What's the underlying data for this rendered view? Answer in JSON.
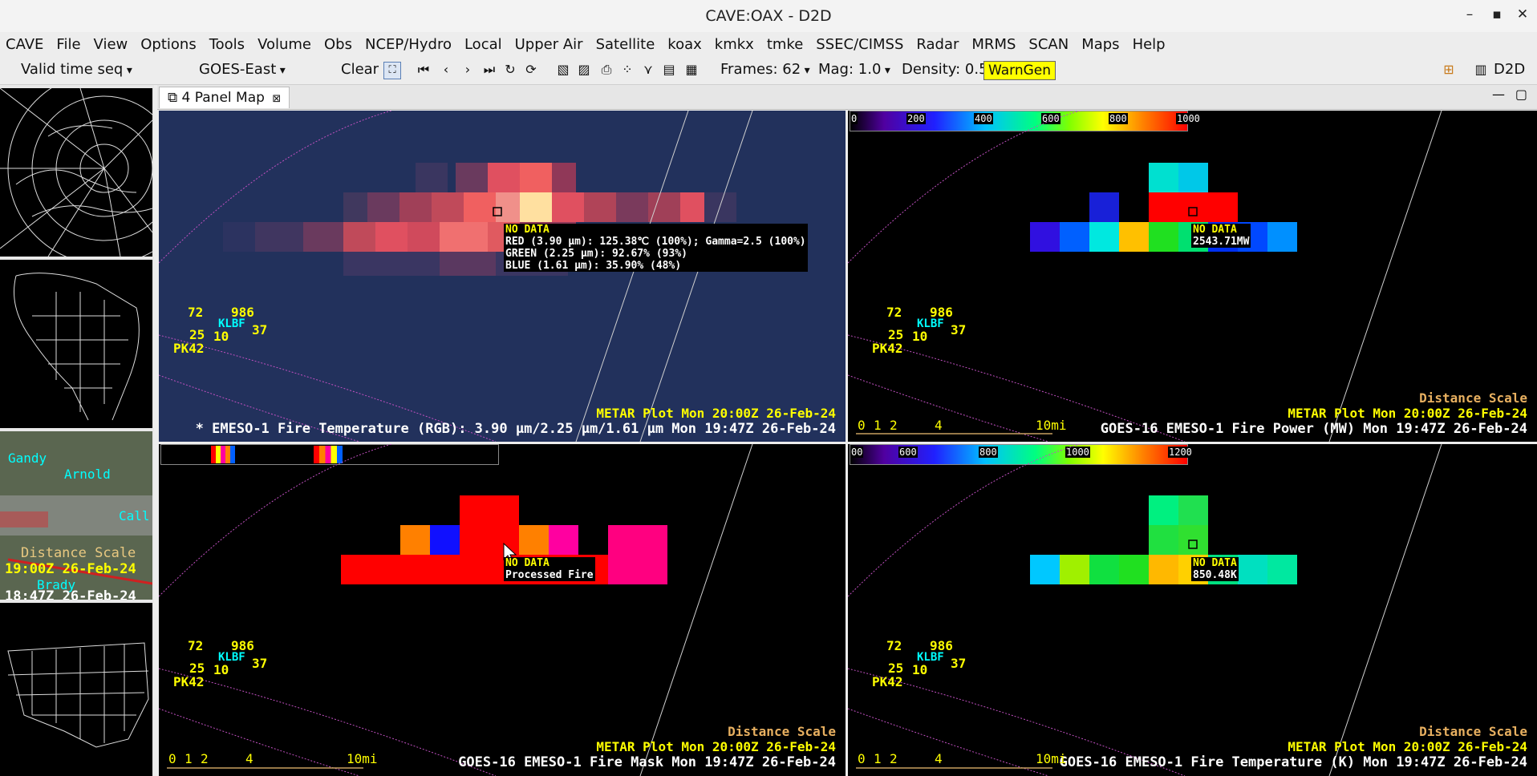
{
  "window": {
    "title": "CAVE:OAX - D2D",
    "minimize": "–",
    "maximize": "▪",
    "close": "✕"
  },
  "menu": [
    "CAVE",
    "File",
    "View",
    "Options",
    "Tools",
    "Volume",
    "Obs",
    "NCEP/Hydro",
    "Local",
    "Upper Air",
    "Satellite",
    "koax",
    "kmkx",
    "tmke",
    "SSEC/CIMSS",
    "Radar",
    "MRMS",
    "SCAN",
    "Maps",
    "Help"
  ],
  "toolbar": {
    "time_mode": "Valid time seq",
    "source": "GOES-East",
    "clear": "Clear",
    "frames": "Frames: 62",
    "mag": "Mag: 1.0",
    "density": "Density: 0.5",
    "warngen": "WarnGen",
    "perspective": "D2D"
  },
  "tab": {
    "label": "4 Panel Map",
    "close": "⊠"
  },
  "side": {
    "towns": [
      "Gandy",
      "Arnold",
      "Call",
      "Brady"
    ],
    "scale_label": "Distance Scale",
    "time1": "19:00Z 26-Feb-24",
    "time2": "18:47Z 26-Feb-24"
  },
  "station": {
    "temp": "72",
    "pressure": "986",
    "dewpoint": "25",
    "vis": "10",
    "id": "KLBF",
    "wind": "37",
    "gust": "PK42"
  },
  "panels": {
    "tl": {
      "sample_nodata": "NO DATA",
      "sample_lines": [
        "RED (3.90 µm): 125.38℃ (100%); Gamma=2.5 (100%)",
        "GREEN (2.25 µm): 92.67% (93%)",
        "BLUE (1.61 µm): 35.90% (48%)"
      ],
      "metar": "METAR Plot  Mon 20:00Z 26-Feb-24",
      "product": "* EMESO-1 Fire Temperature (RGB): 3.90 µm/2.25 µm/1.61 µm Mon 19:47Z 26-Feb-24"
    },
    "tr": {
      "colorbar": [
        "0",
        "200",
        "400",
        "600",
        "800",
        "1000"
      ],
      "sample_nodata": "NO DATA",
      "sample_value": "2543.71MW",
      "scale_label": "Distance Scale",
      "scale_ticks": [
        "0",
        "1",
        "2",
        "4",
        "10mi"
      ],
      "metar": "METAR Plot  Mon 20:00Z 26-Feb-24",
      "product": "GOES-16 EMESO-1 Fire Power (MW)  Mon 19:47Z 26-Feb-24"
    },
    "bl": {
      "sample_nodata": "NO DATA",
      "sample_value": "Processed Fire",
      "scale_label": "Distance Scale",
      "scale_ticks": [
        "0",
        "1",
        "2",
        "4",
        "10mi"
      ],
      "metar": "METAR Plot  Mon 20:00Z 26-Feb-24",
      "product": "GOES-16 EMESO-1 Fire Mask  Mon 19:47Z 26-Feb-24"
    },
    "br": {
      "colorbar": [
        "00",
        "600",
        "800",
        "1000",
        "1200"
      ],
      "sample_nodata": "NO DATA",
      "sample_value": "850.48K",
      "scale_label": "Distance Scale",
      "scale_ticks": [
        "0",
        "1",
        "2",
        "4",
        "10mi"
      ],
      "metar": "METAR Plot  Mon 20:00Z 26-Feb-24",
      "product": "GOES-16 EMESO-1 Fire Temperature (K)  Mon 19:47Z 26-Feb-24"
    }
  }
}
